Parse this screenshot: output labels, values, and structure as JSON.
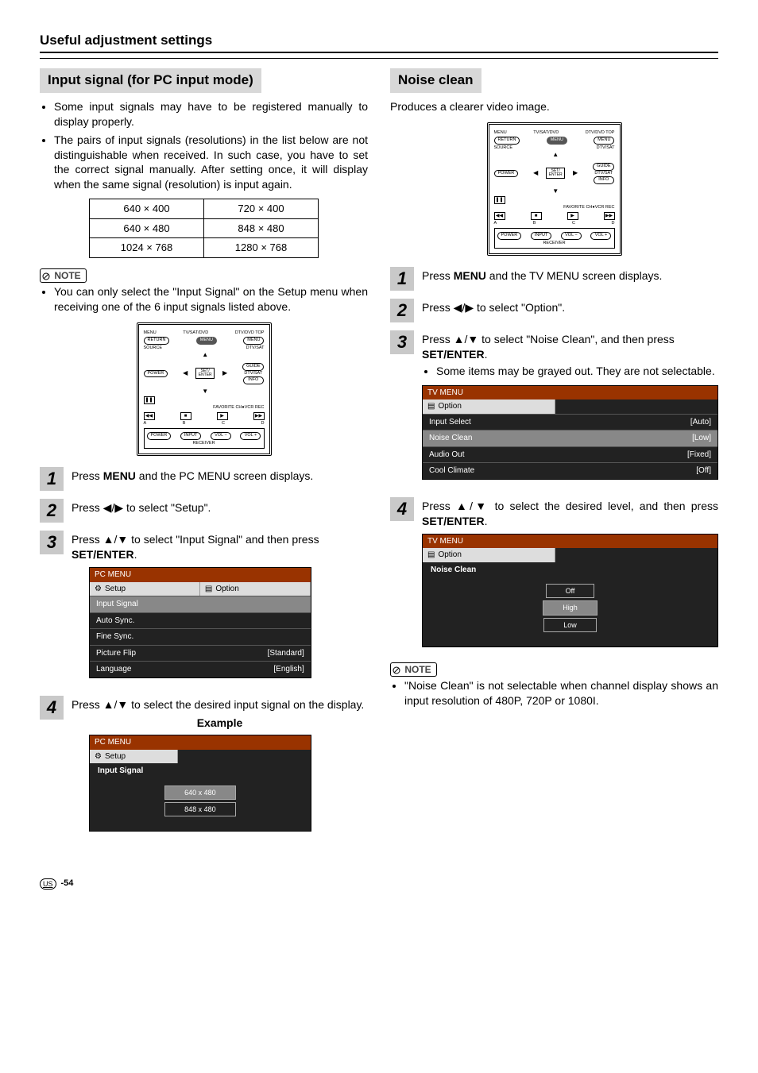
{
  "header": {
    "title": "Useful adjustment settings"
  },
  "left": {
    "title": "Input signal (for PC input mode)",
    "bullets": [
      "Some input signals may have to be registered manually to display properly.",
      "The pairs of input signals (resolutions) in the list below are not distinguishable when received. In such case, you have to set the correct signal manually. After setting once, it will display when the same signal (resolution) is input again."
    ],
    "resolutions": [
      [
        "640 × 400",
        "720 × 400"
      ],
      [
        "640 × 480",
        "848 × 480"
      ],
      [
        "1024 × 768",
        "1280 × 768"
      ]
    ],
    "note_label": "NOTE",
    "note_bullet": "You can only select the \"Input Signal\" on the Setup menu when receiving one of the 6 input signals listed above.",
    "steps": {
      "s1": {
        "pre": "Press ",
        "bold": "MENU",
        "post": " and the PC MENU screen displays."
      },
      "s2": "Press ◀/▶ to select \"Setup\".",
      "s3": {
        "pre": "Press ▲/▼ to select \"Input Signal\" and then press ",
        "bold": "SET/ENTER",
        "post": "."
      },
      "s4": "Press ▲/▼ to select the desired input signal on the display."
    },
    "osd3": {
      "hdr": "PC MENU",
      "tab1": "Setup",
      "tab2": "Option",
      "items": [
        {
          "name": "Input Signal",
          "val": ""
        },
        {
          "name": "Auto Sync.",
          "val": ""
        },
        {
          "name": "Fine Sync.",
          "val": ""
        },
        {
          "name": "Picture Flip",
          "val": "[Standard]"
        },
        {
          "name": "Language",
          "val": "[English]"
        }
      ]
    },
    "example_label": "Example",
    "osd4": {
      "hdr": "PC MENU",
      "tab": "Setup",
      "sub": "Input Signal",
      "opts": [
        "640 x 480",
        "848 x 480"
      ]
    }
  },
  "right": {
    "title": "Noise clean",
    "intro": "Produces a clearer video image.",
    "steps": {
      "s1": {
        "pre": "Press ",
        "bold": "MENU",
        "post": " and the TV MENU screen displays."
      },
      "s2": "Press ◀/▶ to select \"Option\".",
      "s3a": {
        "pre": "Press ▲/▼ to select \"Noise Clean\", and then press ",
        "bold": "SET/ENTER",
        "post": "."
      },
      "s3b": "Some items may be grayed out. They are not selectable.",
      "s4": {
        "pre": "Press ▲/▼ to select the desired level, and then press ",
        "bold": "SET/ENTER",
        "post": "."
      }
    },
    "osd3": {
      "hdr": "TV MENU",
      "tab": "Option",
      "items": [
        {
          "name": "Input Select",
          "val": "[Auto]"
        },
        {
          "name": "Noise Clean",
          "val": "[Low]"
        },
        {
          "name": "Audio Out",
          "val": "[Fixed]"
        },
        {
          "name": "Cool Climate",
          "val": "[Off]"
        }
      ]
    },
    "osd4": {
      "hdr": "TV MENU",
      "tab": "Option",
      "sub": "Noise Clean",
      "opts": [
        "Off",
        "High",
        "Low"
      ]
    },
    "note_label": "NOTE",
    "note_bullet": "\"Noise Clean\" is not selectable when channel display shows an input resolution of 480P, 720P or 1080I."
  },
  "remote": {
    "top": {
      "menu": "MENU",
      "tvsatdvd": "TV/SAT/DVD",
      "dtvdvdtop": "DTV/DVD TOP"
    },
    "row1": {
      "return": "RETURN",
      "menu": "MENU",
      "menu2": "MENU"
    },
    "row2_left": "SOURCE",
    "row2_right": "DTV/SAT",
    "row3_left": "POWER",
    "row3_center": "SET/\nENTER",
    "row3_right": "GUIDE",
    "row4_right_a": "DTV/SAT",
    "row4_right_b": "INFO",
    "pause": "❚❚",
    "fav": "FAVORITE CH",
    "vcr": "VCR REC",
    "tr": {
      "a": "A",
      "b": "B",
      "c": "C",
      "d": "D",
      "rw": "◀◀",
      "stop": "■",
      "play": "▶",
      "ff": "▶▶"
    },
    "rxrow": {
      "power": "POWER",
      "input": "INPUT",
      "volm": "VOL −",
      "volp": "VOL +",
      "label": "RECEIVER"
    }
  },
  "footer": {
    "us": "US",
    "page": "-54"
  }
}
